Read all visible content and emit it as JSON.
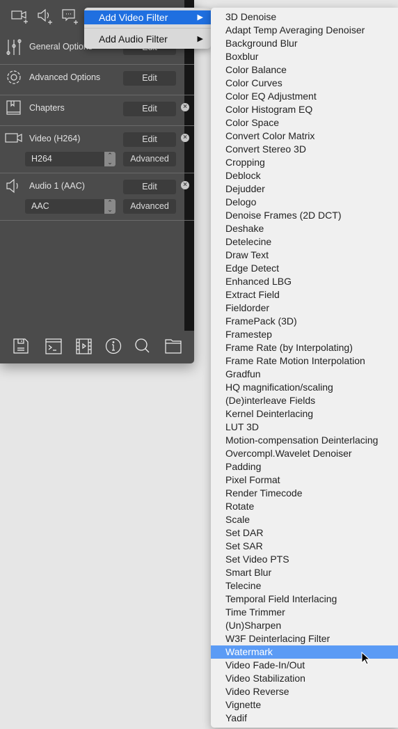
{
  "toolbar": {
    "icons": [
      "add-video-icon",
      "add-audio-icon",
      "add-subtitle-icon"
    ]
  },
  "rows": [
    {
      "label": "General Options",
      "button": "Edit"
    },
    {
      "label": "Advanced Options",
      "button": "Edit"
    },
    {
      "label": "Chapters",
      "button": "Edit"
    },
    {
      "label": "Video (H264)",
      "button": "Edit",
      "codec": "H264",
      "advanced": "Advanced"
    },
    {
      "label": "Audio 1 (AAC)",
      "button": "Edit",
      "codec": "AAC",
      "advanced": "Advanced"
    }
  ],
  "bottom_icons": [
    "save-icon",
    "terminal-icon",
    "film-icon",
    "info-icon",
    "search-icon",
    "folder-icon"
  ],
  "context_menu": [
    {
      "label": "Add Video Filter",
      "highlighted": true
    },
    {
      "label": "Add Audio Filter",
      "highlighted": false
    }
  ],
  "submenu": {
    "highlighted": "Watermark",
    "items": [
      "3D Denoise",
      "Adapt Temp Averaging Denoiser",
      "Background Blur",
      "Boxblur",
      "Color Balance",
      "Color Curves",
      "Color EQ Adjustment",
      "Color Histogram EQ",
      "Color Space",
      "Convert Color Matrix",
      "Convert Stereo 3D",
      "Cropping",
      "Deblock",
      "Dejudder",
      "Delogo",
      "Denoise Frames (2D DCT)",
      "Deshake",
      "Detelecine",
      "Draw Text",
      "Edge Detect",
      "Enhanced LBG",
      "Extract Field",
      "Fieldorder",
      "FramePack (3D)",
      "Framestep",
      "Frame Rate (by Interpolating)",
      "Frame Rate Motion Interpolation",
      "Gradfun",
      "HQ magnification/scaling",
      "(De)interleave Fields",
      "Kernel Deinterlacing",
      "LUT 3D",
      "Motion-compensation Deinterlacing",
      "Overcompl.Wavelet Denoiser",
      "Padding",
      "Pixel Format",
      "Render Timecode",
      "Rotate",
      "Scale",
      "Set DAR",
      "Set SAR",
      "Set Video PTS",
      "Smart Blur",
      "Telecine",
      "Temporal Field Interlacing",
      "Time Trimmer",
      "(Un)Sharpen",
      "W3F Deinterlacing Filter",
      "Watermark",
      "Video Fade-In/Out",
      "Video Stabilization",
      "Video Reverse",
      "Vignette",
      "Yadif"
    ]
  },
  "colors": {
    "panel": "#4b4b4b",
    "menu_highlight": "#1f6fe0",
    "submenu_highlight": "#5b9bf5"
  }
}
